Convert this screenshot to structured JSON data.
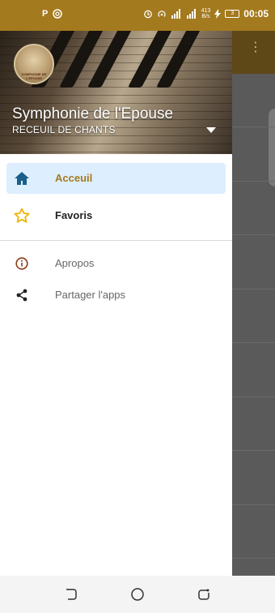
{
  "status_bar": {
    "time": "00:05",
    "network_speed": "413\nB/s",
    "battery_level": "3",
    "left_icons": [
      "parking-icon",
      "at-sign-icon"
    ],
    "right_icons": [
      "alarm-icon",
      "hotspot-icon",
      "signal-icon",
      "signal-icon",
      "charging-icon"
    ]
  },
  "drawer": {
    "header": {
      "title": "Symphonie de l'Epouse",
      "subtitle": "RECEUIL DE CHANTS",
      "avatar_caption": "SYMPHONIE DE L'EPOUSE"
    },
    "items": [
      {
        "label": "Acceuil",
        "icon": "home-icon",
        "active": true
      },
      {
        "label": "Favoris",
        "icon": "star-icon",
        "active": false
      },
      {
        "label": "Apropos",
        "icon": "info-icon",
        "active": false
      },
      {
        "label": "Partager l'apps",
        "icon": "share-icon",
        "active": false
      }
    ]
  },
  "colors": {
    "brand": "#a47a1e",
    "active_bg": "#ddeefe",
    "home_icon": "#1a5f8a",
    "star_icon": "#f0b400",
    "info_icon": "#8b3a14"
  },
  "nav_bar": {
    "buttons": [
      "back-icon",
      "home-circle-icon",
      "recent-apps-icon"
    ]
  }
}
